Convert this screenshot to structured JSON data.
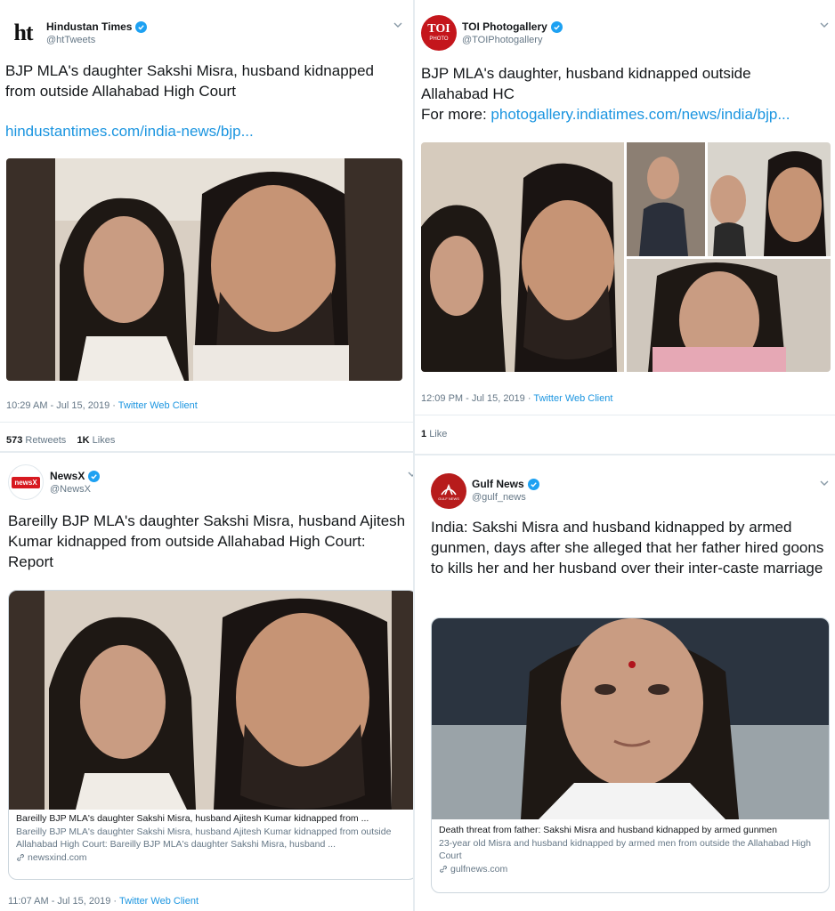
{
  "tweets": [
    {
      "name": "Hindustan Times",
      "handle": "@htTweets",
      "avatar_text": "ht",
      "text": "BJP MLA's daughter Sakshi Misra, husband kidnapped from outside Allahabad High Court",
      "link": "hindustantimes.com/india-news/bjp...",
      "timestamp": "10:29 AM - Jul 15, 2019 · ",
      "client": "Twitter Web Client",
      "retweets": "573",
      "retweets_label": "Retweets",
      "likes": "1K",
      "likes_label": "Likes"
    },
    {
      "name": "TOI Photogallery",
      "handle": "@TOIPhotogallery",
      "avatar_text": "TOI",
      "avatar_sub": "PHOTO",
      "text": "BJP MLA's daughter, husband kidnapped outside Allahabad HC",
      "text_more": "For more: ",
      "link": "photogallery.indiatimes.com/news/india/bjp...",
      "timestamp": "12:09 PM - Jul 15, 2019 · ",
      "client": "Twitter Web Client",
      "likes": "1",
      "likes_label": "Like"
    },
    {
      "name": "NewsX",
      "handle": "@NewsX",
      "avatar_text": "newsX",
      "text": "Bareilly BJP MLA's daughter Sakshi Misra, husband Ajitesh Kumar kidnapped from outside Allahabad High Court: Report",
      "card_title": "Bareilly BJP MLA's daughter Sakshi Misra, husband Ajitesh Kumar kidnapped from ...",
      "card_desc": "Bareilly BJP MLA's daughter Sakshi Misra, husband Ajitesh Kumar kidnapped from outside Allahabad High Court: Bareilly BJP MLA's daughter Sakshi Misra, husband ...",
      "card_domain": "newsxind.com",
      "timestamp": "11:07 AM - Jul 15, 2019 · ",
      "client": "Twitter Web Client"
    },
    {
      "name": "Gulf News",
      "handle": "@gulf_news",
      "avatar_text": "GULF NEWS",
      "text": "India: Sakshi Misra and husband kidnapped by armed gunmen, days after she alleged that her father hired goons to kills her and her husband over their inter-caste marriage",
      "card_title": "Death threat from father: Sakshi Misra and husband kidnapped by armed gunmen",
      "card_desc": "23-year old Misra and husband kidnapped by armed men from outside the Allahabad High Court",
      "card_domain": "gulfnews.com"
    }
  ],
  "colors": {
    "verified": "#1da1f2",
    "link": "#1b95e0",
    "muted": "#657786",
    "toi_red": "#c4161c",
    "newsx_red": "#d71920",
    "gulf_red": "#b71c1c"
  }
}
